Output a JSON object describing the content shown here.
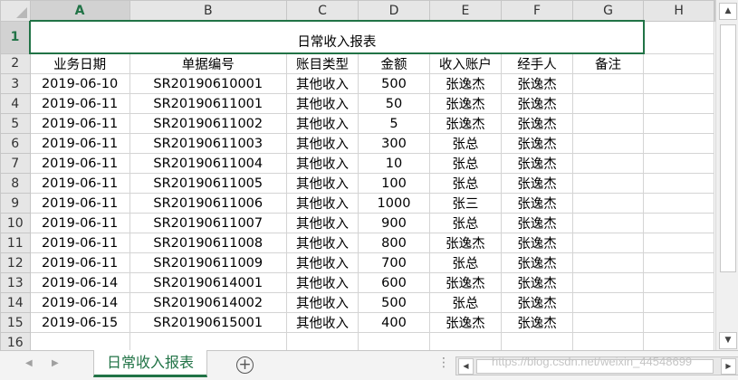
{
  "sheet": {
    "columns": [
      "A",
      "B",
      "C",
      "D",
      "E",
      "F",
      "G",
      "H"
    ],
    "title": "日常收入报表",
    "headers": [
      "业务日期",
      "单据编号",
      "账目类型",
      "金额",
      "收入账户",
      "经手人",
      "备注"
    ],
    "rows": [
      [
        "2019-06-10",
        "SR20190610001",
        "其他收入",
        "500",
        "张逸杰",
        "张逸杰",
        ""
      ],
      [
        "2019-06-11",
        "SR20190611001",
        "其他收入",
        "50",
        "张逸杰",
        "张逸杰",
        ""
      ],
      [
        "2019-06-11",
        "SR20190611002",
        "其他收入",
        "5",
        "张逸杰",
        "张逸杰",
        ""
      ],
      [
        "2019-06-11",
        "SR20190611003",
        "其他收入",
        "300",
        "张总",
        "张逸杰",
        ""
      ],
      [
        "2019-06-11",
        "SR20190611004",
        "其他收入",
        "10",
        "张总",
        "张逸杰",
        ""
      ],
      [
        "2019-06-11",
        "SR20190611005",
        "其他收入",
        "100",
        "张总",
        "张逸杰",
        ""
      ],
      [
        "2019-06-11",
        "SR20190611006",
        "其他收入",
        "1000",
        "张三",
        "张逸杰",
        ""
      ],
      [
        "2019-06-11",
        "SR20190611007",
        "其他收入",
        "900",
        "张总",
        "张逸杰",
        ""
      ],
      [
        "2019-06-11",
        "SR20190611008",
        "其他收入",
        "800",
        "张逸杰",
        "张逸杰",
        ""
      ],
      [
        "2019-06-11",
        "SR20190611009",
        "其他收入",
        "700",
        "张总",
        "张逸杰",
        ""
      ],
      [
        "2019-06-14",
        "SR20190614001",
        "其他收入",
        "600",
        "张逸杰",
        "张逸杰",
        ""
      ],
      [
        "2019-06-14",
        "SR20190614002",
        "其他收入",
        "500",
        "张总",
        "张逸杰",
        ""
      ],
      [
        "2019-06-15",
        "SR20190615001",
        "其他收入",
        "400",
        "张逸杰",
        "张逸杰",
        ""
      ]
    ]
  },
  "tabs": {
    "active": "日常收入报表"
  },
  "watermark": "https://blog.csdn.net/weixin_44548699",
  "colors": {
    "accent": "#217346",
    "header_bg": "#e6e6e6",
    "gridline": "#d4d4d4"
  },
  "icons": {
    "scroll_up": "triangle-up",
    "scroll_down": "triangle-down",
    "tab_prev": "triangle-left",
    "tab_next": "triangle-right",
    "add_sheet": "plus-circle",
    "more": "ellipsis-vertical"
  }
}
